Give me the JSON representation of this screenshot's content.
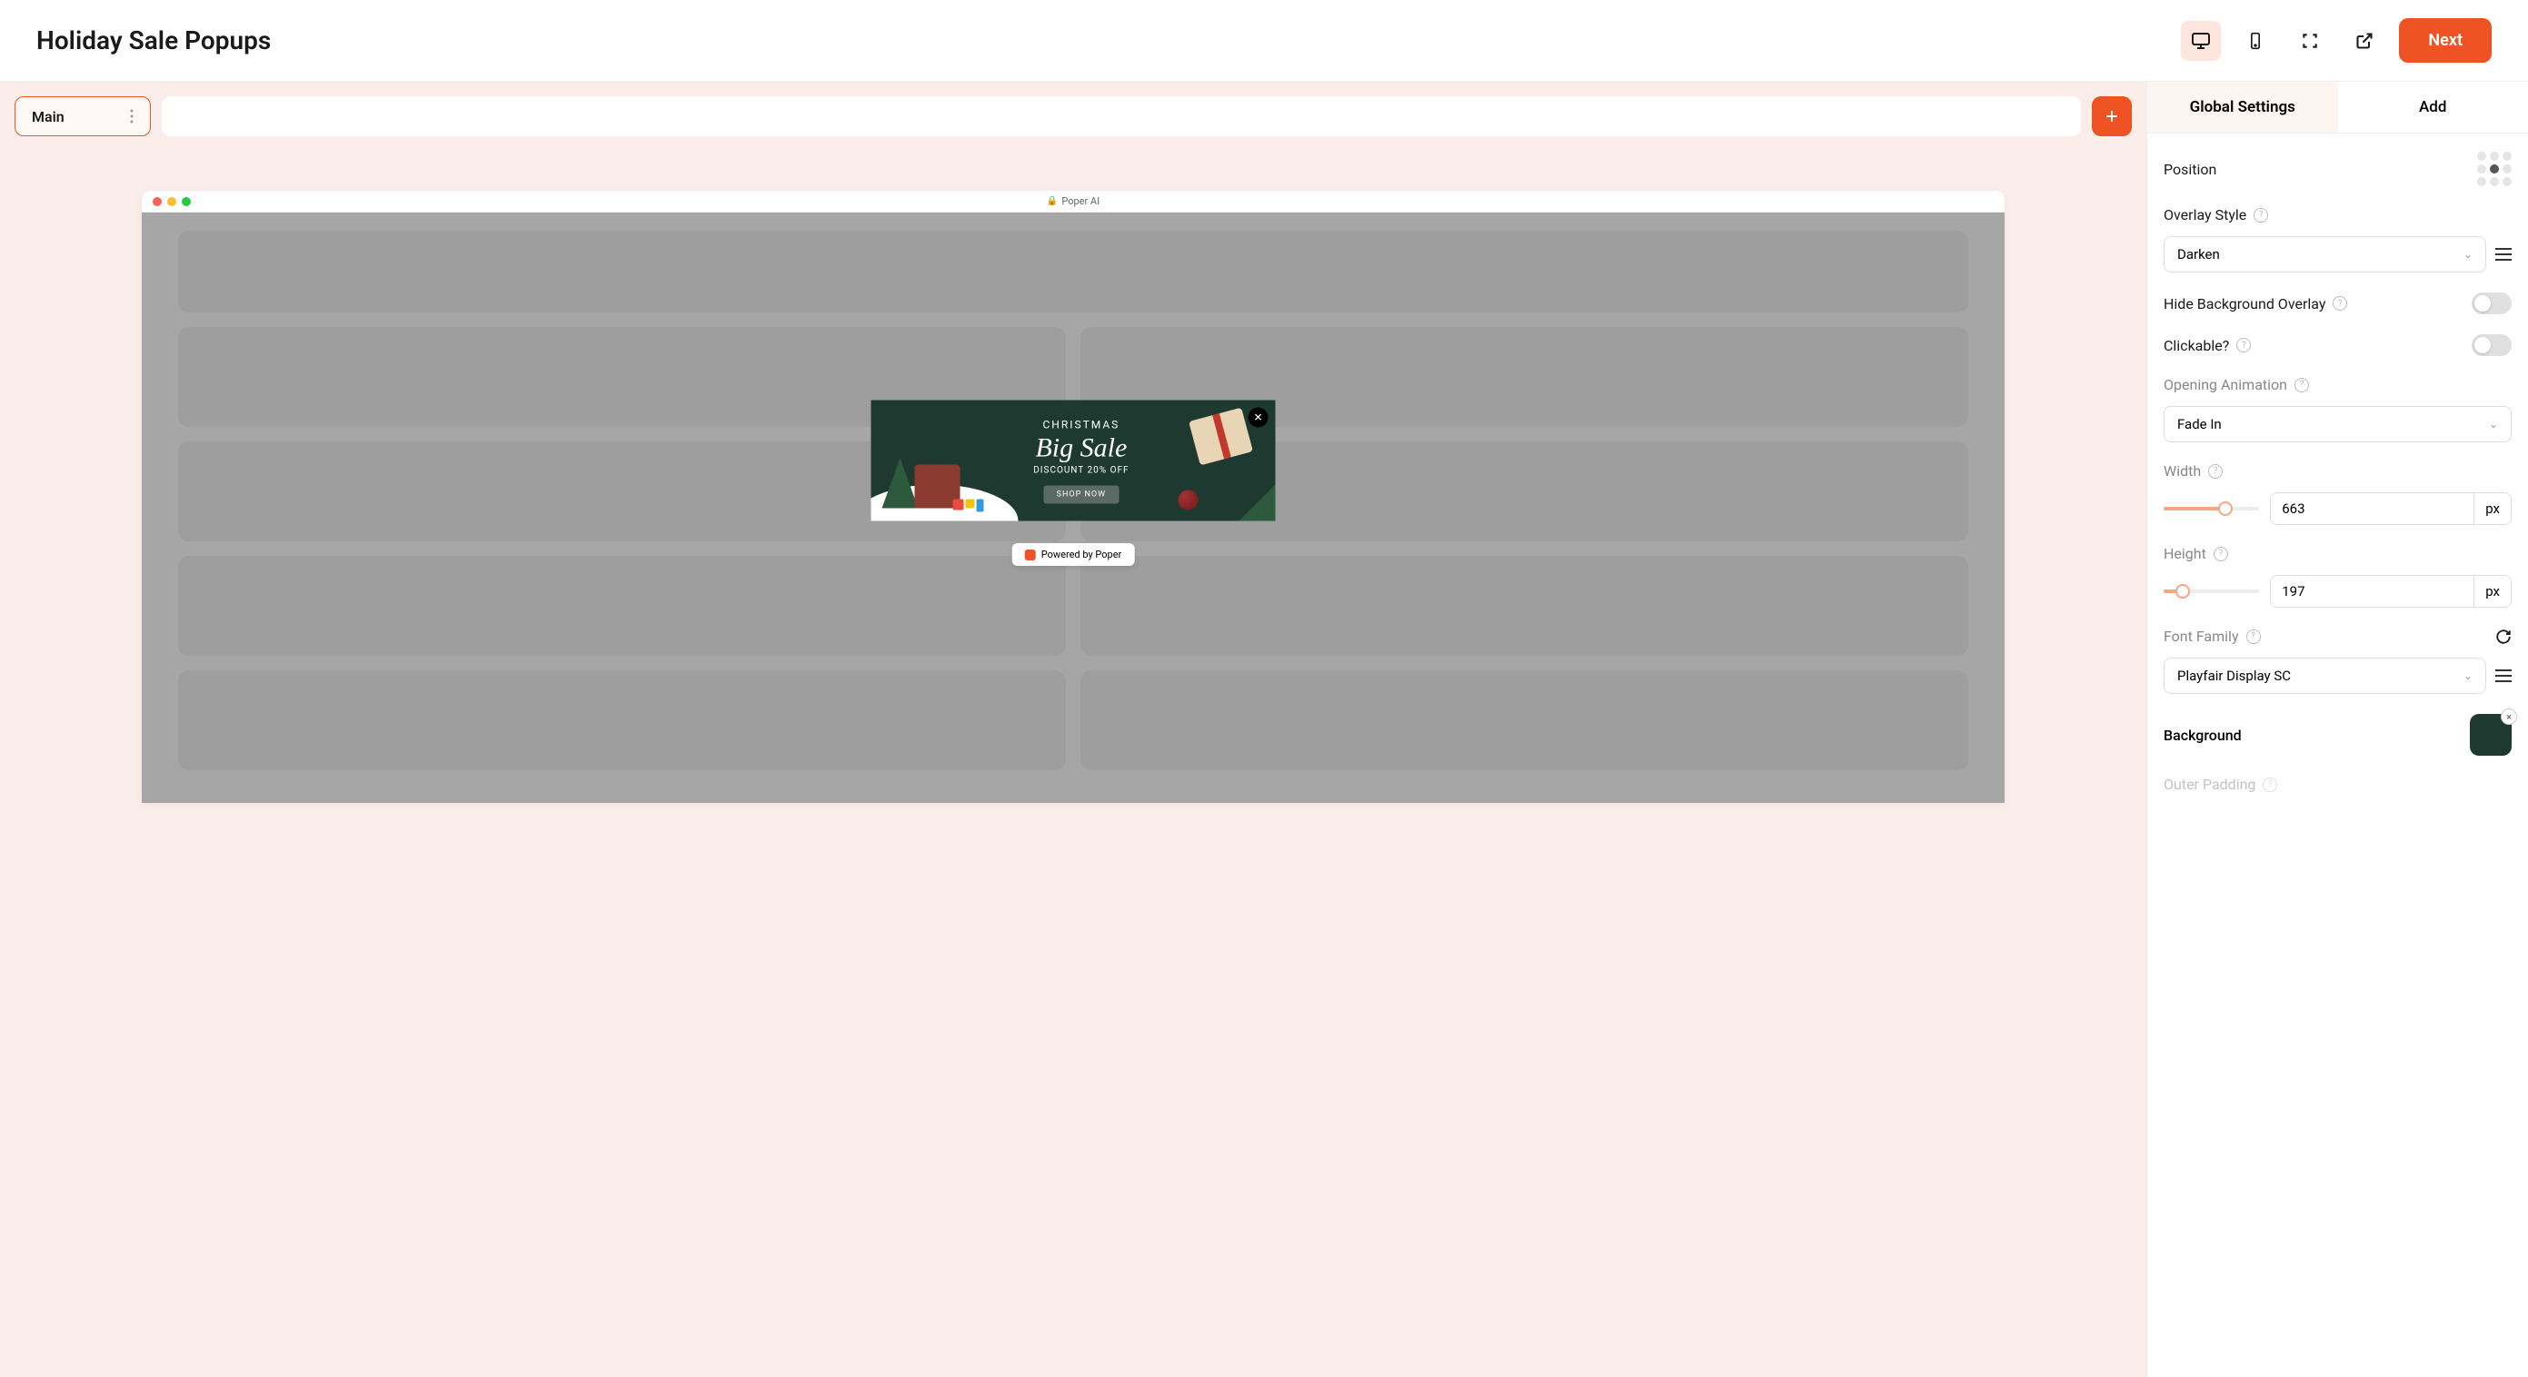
{
  "header": {
    "title": "Holiday Sale Popups",
    "next_label": "Next"
  },
  "toolbar": {
    "step_label": "Main"
  },
  "browser": {
    "title": "Poper AI"
  },
  "popup": {
    "eyebrow": "CHRISTMAS",
    "headline": "Big Sale",
    "sub": "DISCOUNT 20% OFF",
    "cta": "SHOP NOW",
    "close": "✕"
  },
  "powered": {
    "label": "Powered by Poper"
  },
  "panel": {
    "tabs": {
      "global": "Global Settings",
      "add": "Add"
    },
    "position_label": "Position",
    "position_active_index": 4,
    "overlay": {
      "label": "Overlay Style",
      "value": "Darken"
    },
    "hide_bg": {
      "label": "Hide Background Overlay",
      "value": false
    },
    "clickable": {
      "label": "Clickable?",
      "value": false
    },
    "animation": {
      "label": "Opening Animation",
      "value": "Fade In"
    },
    "width": {
      "label": "Width",
      "value": "663",
      "unit": "px",
      "percent": 65
    },
    "height": {
      "label": "Height",
      "value": "197",
      "unit": "px",
      "percent": 20
    },
    "font": {
      "label": "Font Family",
      "value": "Playfair Display SC"
    },
    "background": {
      "label": "Background",
      "color": "#1E3A30"
    },
    "outer_padding": {
      "label": "Outer Padding"
    }
  }
}
